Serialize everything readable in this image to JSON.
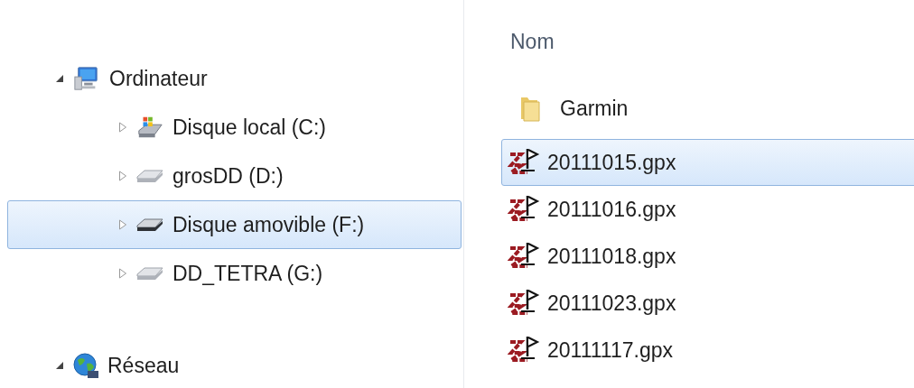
{
  "navigation_tree": [
    {
      "label": "Ordinateur",
      "kind": "computer",
      "expanded": true,
      "selected": false,
      "children": [
        {
          "label": "Disque local (C:)",
          "kind": "system-drive",
          "expanded": false,
          "selected": false
        },
        {
          "label": "grosDD (D:)",
          "kind": "drive",
          "expanded": false,
          "selected": false
        },
        {
          "label": "Disque amovible (F:)",
          "kind": "removable",
          "expanded": false,
          "selected": true
        },
        {
          "label": "DD_TETRA (G:)",
          "kind": "drive",
          "expanded": false,
          "selected": false
        }
      ]
    },
    {
      "label": "Réseau",
      "kind": "network",
      "expanded": true,
      "selected": false
    }
  ],
  "file_list": {
    "column_header": "Nom",
    "items": [
      {
        "name": "Garmin",
        "kind": "folder",
        "selected": false
      },
      {
        "name": "20111015.gpx",
        "kind": "gpx",
        "selected": true
      },
      {
        "name": "20111016.gpx",
        "kind": "gpx",
        "selected": false
      },
      {
        "name": "20111018.gpx",
        "kind": "gpx",
        "selected": false
      },
      {
        "name": "20111023.gpx",
        "kind": "gpx",
        "selected": false
      },
      {
        "name": "20111117.gpx",
        "kind": "gpx",
        "selected": false
      }
    ]
  }
}
